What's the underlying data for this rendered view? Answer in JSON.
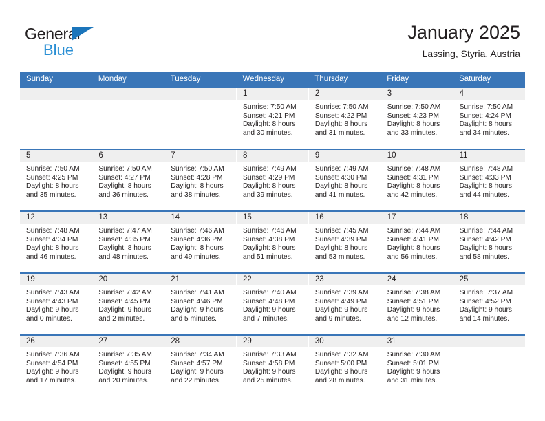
{
  "brand": {
    "name_part1": "General",
    "name_part2": "Blue",
    "triangle_icon": "triangle-icon",
    "color_dark": "#231f20",
    "color_blue": "#2a8fd4"
  },
  "header": {
    "title": "January 2025",
    "subtitle": "Lassing, Styria, Austria"
  },
  "theme": {
    "header_blue": "#3a76b8",
    "daynum_strip": "#efefef",
    "text": "#231f20"
  },
  "labels": {
    "sunrise_prefix": "Sunrise:",
    "sunset_prefix": "Sunset:",
    "daylight_prefix": "Daylight:"
  },
  "weekdays": [
    "Sunday",
    "Monday",
    "Tuesday",
    "Wednesday",
    "Thursday",
    "Friday",
    "Saturday"
  ],
  "weeks": [
    [
      {
        "empty": true,
        "day": "",
        "sunrise": "",
        "sunset": "",
        "daylight_l1": "",
        "daylight_l2": ""
      },
      {
        "empty": true,
        "day": "",
        "sunrise": "",
        "sunset": "",
        "daylight_l1": "",
        "daylight_l2": ""
      },
      {
        "empty": true,
        "day": "",
        "sunrise": "",
        "sunset": "",
        "daylight_l1": "",
        "daylight_l2": ""
      },
      {
        "empty": false,
        "day": "1",
        "sunrise": "Sunrise: 7:50 AM",
        "sunset": "Sunset: 4:21 PM",
        "daylight_l1": "Daylight: 8 hours",
        "daylight_l2": "and 30 minutes."
      },
      {
        "empty": false,
        "day": "2",
        "sunrise": "Sunrise: 7:50 AM",
        "sunset": "Sunset: 4:22 PM",
        "daylight_l1": "Daylight: 8 hours",
        "daylight_l2": "and 31 minutes."
      },
      {
        "empty": false,
        "day": "3",
        "sunrise": "Sunrise: 7:50 AM",
        "sunset": "Sunset: 4:23 PM",
        "daylight_l1": "Daylight: 8 hours",
        "daylight_l2": "and 33 minutes."
      },
      {
        "empty": false,
        "day": "4",
        "sunrise": "Sunrise: 7:50 AM",
        "sunset": "Sunset: 4:24 PM",
        "daylight_l1": "Daylight: 8 hours",
        "daylight_l2": "and 34 minutes."
      }
    ],
    [
      {
        "empty": false,
        "day": "5",
        "sunrise": "Sunrise: 7:50 AM",
        "sunset": "Sunset: 4:25 PM",
        "daylight_l1": "Daylight: 8 hours",
        "daylight_l2": "and 35 minutes."
      },
      {
        "empty": false,
        "day": "6",
        "sunrise": "Sunrise: 7:50 AM",
        "sunset": "Sunset: 4:27 PM",
        "daylight_l1": "Daylight: 8 hours",
        "daylight_l2": "and 36 minutes."
      },
      {
        "empty": false,
        "day": "7",
        "sunrise": "Sunrise: 7:50 AM",
        "sunset": "Sunset: 4:28 PM",
        "daylight_l1": "Daylight: 8 hours",
        "daylight_l2": "and 38 minutes."
      },
      {
        "empty": false,
        "day": "8",
        "sunrise": "Sunrise: 7:49 AM",
        "sunset": "Sunset: 4:29 PM",
        "daylight_l1": "Daylight: 8 hours",
        "daylight_l2": "and 39 minutes."
      },
      {
        "empty": false,
        "day": "9",
        "sunrise": "Sunrise: 7:49 AM",
        "sunset": "Sunset: 4:30 PM",
        "daylight_l1": "Daylight: 8 hours",
        "daylight_l2": "and 41 minutes."
      },
      {
        "empty": false,
        "day": "10",
        "sunrise": "Sunrise: 7:48 AM",
        "sunset": "Sunset: 4:31 PM",
        "daylight_l1": "Daylight: 8 hours",
        "daylight_l2": "and 42 minutes."
      },
      {
        "empty": false,
        "day": "11",
        "sunrise": "Sunrise: 7:48 AM",
        "sunset": "Sunset: 4:33 PM",
        "daylight_l1": "Daylight: 8 hours",
        "daylight_l2": "and 44 minutes."
      }
    ],
    [
      {
        "empty": false,
        "day": "12",
        "sunrise": "Sunrise: 7:48 AM",
        "sunset": "Sunset: 4:34 PM",
        "daylight_l1": "Daylight: 8 hours",
        "daylight_l2": "and 46 minutes."
      },
      {
        "empty": false,
        "day": "13",
        "sunrise": "Sunrise: 7:47 AM",
        "sunset": "Sunset: 4:35 PM",
        "daylight_l1": "Daylight: 8 hours",
        "daylight_l2": "and 48 minutes."
      },
      {
        "empty": false,
        "day": "14",
        "sunrise": "Sunrise: 7:46 AM",
        "sunset": "Sunset: 4:36 PM",
        "daylight_l1": "Daylight: 8 hours",
        "daylight_l2": "and 49 minutes."
      },
      {
        "empty": false,
        "day": "15",
        "sunrise": "Sunrise: 7:46 AM",
        "sunset": "Sunset: 4:38 PM",
        "daylight_l1": "Daylight: 8 hours",
        "daylight_l2": "and 51 minutes."
      },
      {
        "empty": false,
        "day": "16",
        "sunrise": "Sunrise: 7:45 AM",
        "sunset": "Sunset: 4:39 PM",
        "daylight_l1": "Daylight: 8 hours",
        "daylight_l2": "and 53 minutes."
      },
      {
        "empty": false,
        "day": "17",
        "sunrise": "Sunrise: 7:44 AM",
        "sunset": "Sunset: 4:41 PM",
        "daylight_l1": "Daylight: 8 hours",
        "daylight_l2": "and 56 minutes."
      },
      {
        "empty": false,
        "day": "18",
        "sunrise": "Sunrise: 7:44 AM",
        "sunset": "Sunset: 4:42 PM",
        "daylight_l1": "Daylight: 8 hours",
        "daylight_l2": "and 58 minutes."
      }
    ],
    [
      {
        "empty": false,
        "day": "19",
        "sunrise": "Sunrise: 7:43 AM",
        "sunset": "Sunset: 4:43 PM",
        "daylight_l1": "Daylight: 9 hours",
        "daylight_l2": "and 0 minutes."
      },
      {
        "empty": false,
        "day": "20",
        "sunrise": "Sunrise: 7:42 AM",
        "sunset": "Sunset: 4:45 PM",
        "daylight_l1": "Daylight: 9 hours",
        "daylight_l2": "and 2 minutes."
      },
      {
        "empty": false,
        "day": "21",
        "sunrise": "Sunrise: 7:41 AM",
        "sunset": "Sunset: 4:46 PM",
        "daylight_l1": "Daylight: 9 hours",
        "daylight_l2": "and 5 minutes."
      },
      {
        "empty": false,
        "day": "22",
        "sunrise": "Sunrise: 7:40 AM",
        "sunset": "Sunset: 4:48 PM",
        "daylight_l1": "Daylight: 9 hours",
        "daylight_l2": "and 7 minutes."
      },
      {
        "empty": false,
        "day": "23",
        "sunrise": "Sunrise: 7:39 AM",
        "sunset": "Sunset: 4:49 PM",
        "daylight_l1": "Daylight: 9 hours",
        "daylight_l2": "and 9 minutes."
      },
      {
        "empty": false,
        "day": "24",
        "sunrise": "Sunrise: 7:38 AM",
        "sunset": "Sunset: 4:51 PM",
        "daylight_l1": "Daylight: 9 hours",
        "daylight_l2": "and 12 minutes."
      },
      {
        "empty": false,
        "day": "25",
        "sunrise": "Sunrise: 7:37 AM",
        "sunset": "Sunset: 4:52 PM",
        "daylight_l1": "Daylight: 9 hours",
        "daylight_l2": "and 14 minutes."
      }
    ],
    [
      {
        "empty": false,
        "day": "26",
        "sunrise": "Sunrise: 7:36 AM",
        "sunset": "Sunset: 4:54 PM",
        "daylight_l1": "Daylight: 9 hours",
        "daylight_l2": "and 17 minutes."
      },
      {
        "empty": false,
        "day": "27",
        "sunrise": "Sunrise: 7:35 AM",
        "sunset": "Sunset: 4:55 PM",
        "daylight_l1": "Daylight: 9 hours",
        "daylight_l2": "and 20 minutes."
      },
      {
        "empty": false,
        "day": "28",
        "sunrise": "Sunrise: 7:34 AM",
        "sunset": "Sunset: 4:57 PM",
        "daylight_l1": "Daylight: 9 hours",
        "daylight_l2": "and 22 minutes."
      },
      {
        "empty": false,
        "day": "29",
        "sunrise": "Sunrise: 7:33 AM",
        "sunset": "Sunset: 4:58 PM",
        "daylight_l1": "Daylight: 9 hours",
        "daylight_l2": "and 25 minutes."
      },
      {
        "empty": false,
        "day": "30",
        "sunrise": "Sunrise: 7:32 AM",
        "sunset": "Sunset: 5:00 PM",
        "daylight_l1": "Daylight: 9 hours",
        "daylight_l2": "and 28 minutes."
      },
      {
        "empty": false,
        "day": "31",
        "sunrise": "Sunrise: 7:30 AM",
        "sunset": "Sunset: 5:01 PM",
        "daylight_l1": "Daylight: 9 hours",
        "daylight_l2": "and 31 minutes."
      },
      {
        "empty": true,
        "day": "",
        "sunrise": "",
        "sunset": "",
        "daylight_l1": "",
        "daylight_l2": ""
      }
    ]
  ]
}
